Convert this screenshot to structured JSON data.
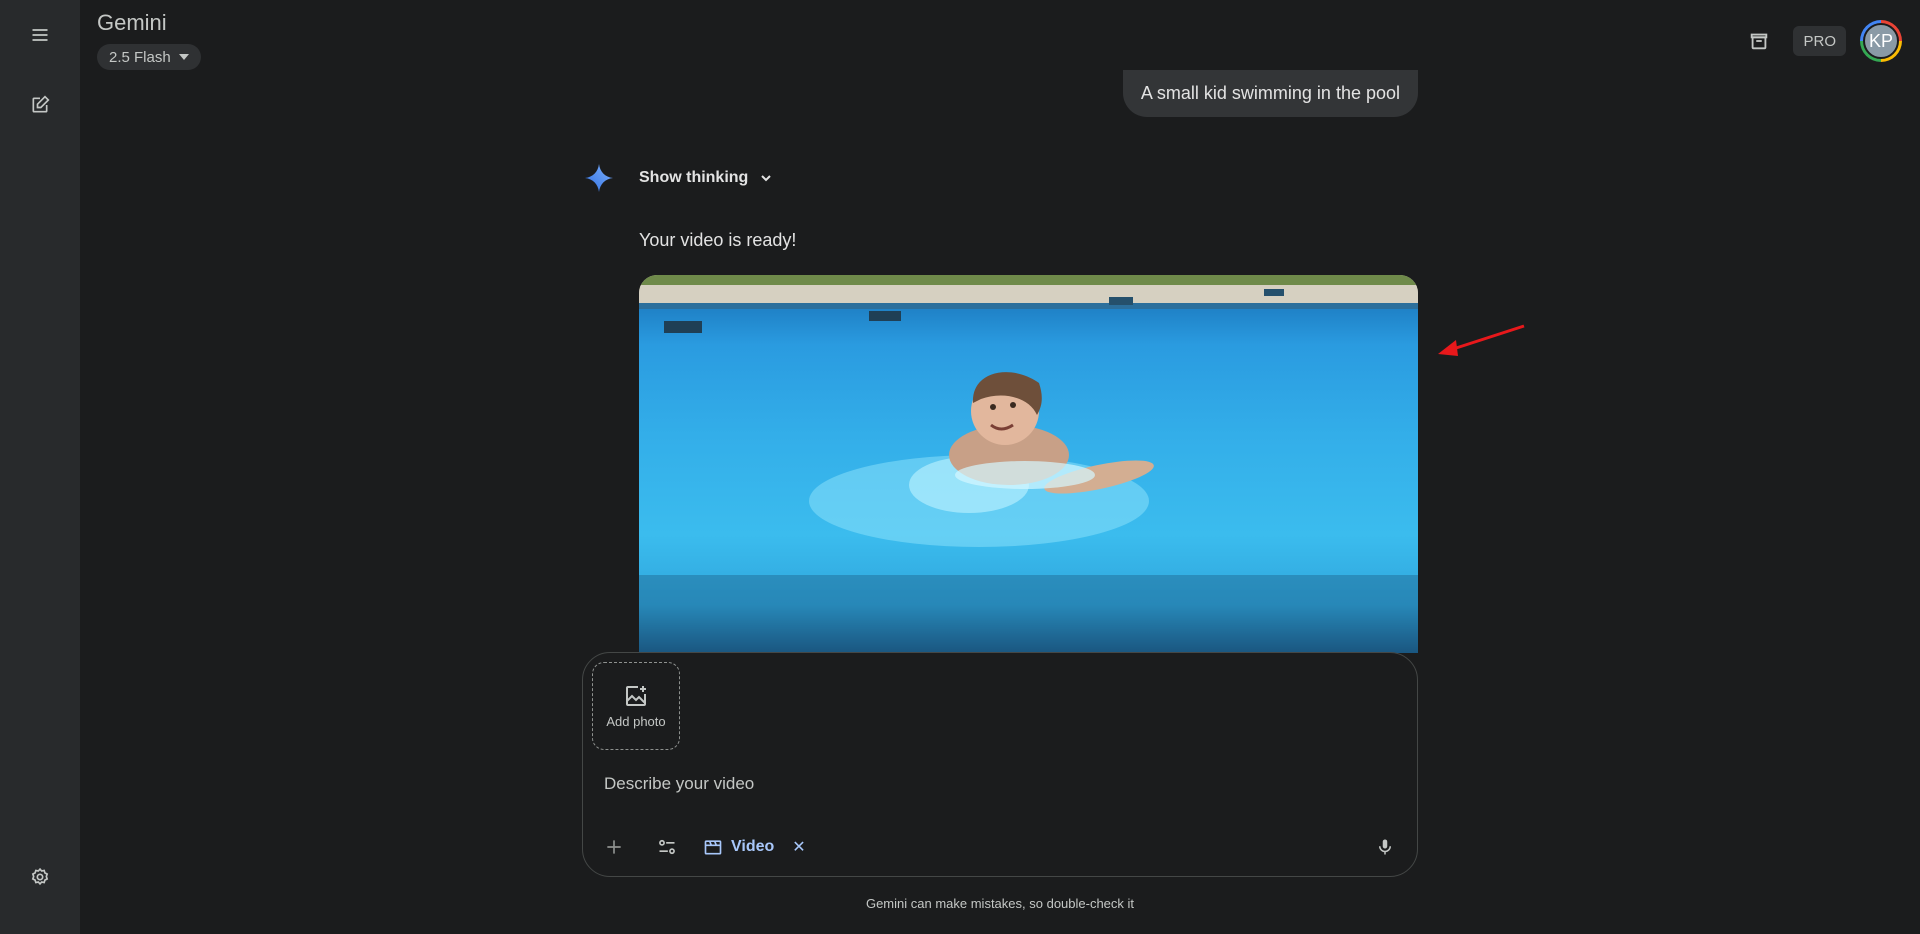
{
  "app": {
    "title": "Gemini",
    "model": "2.5 Flash",
    "badge": "PRO",
    "avatar_initials": "KP"
  },
  "sidebar": {
    "icons": [
      "menu-icon",
      "new-chat-icon",
      "settings-icon"
    ]
  },
  "conversation": {
    "user_prompt": "A small kid swimming in the pool",
    "show_thinking_label": "Show thinking",
    "response_text": "Your video is ready!"
  },
  "composer": {
    "add_photo_label": "Add photo",
    "placeholder": "Describe your video",
    "tool_chip_label": "Video",
    "tool_chip_close": "✕"
  },
  "footer": {
    "disclaimer": "Gemini can make mistakes, so double-check it"
  },
  "colors": {
    "accent": "#a8c7fa",
    "arrow": "#e8181b",
    "gemini_star": "#4f8ff7"
  }
}
